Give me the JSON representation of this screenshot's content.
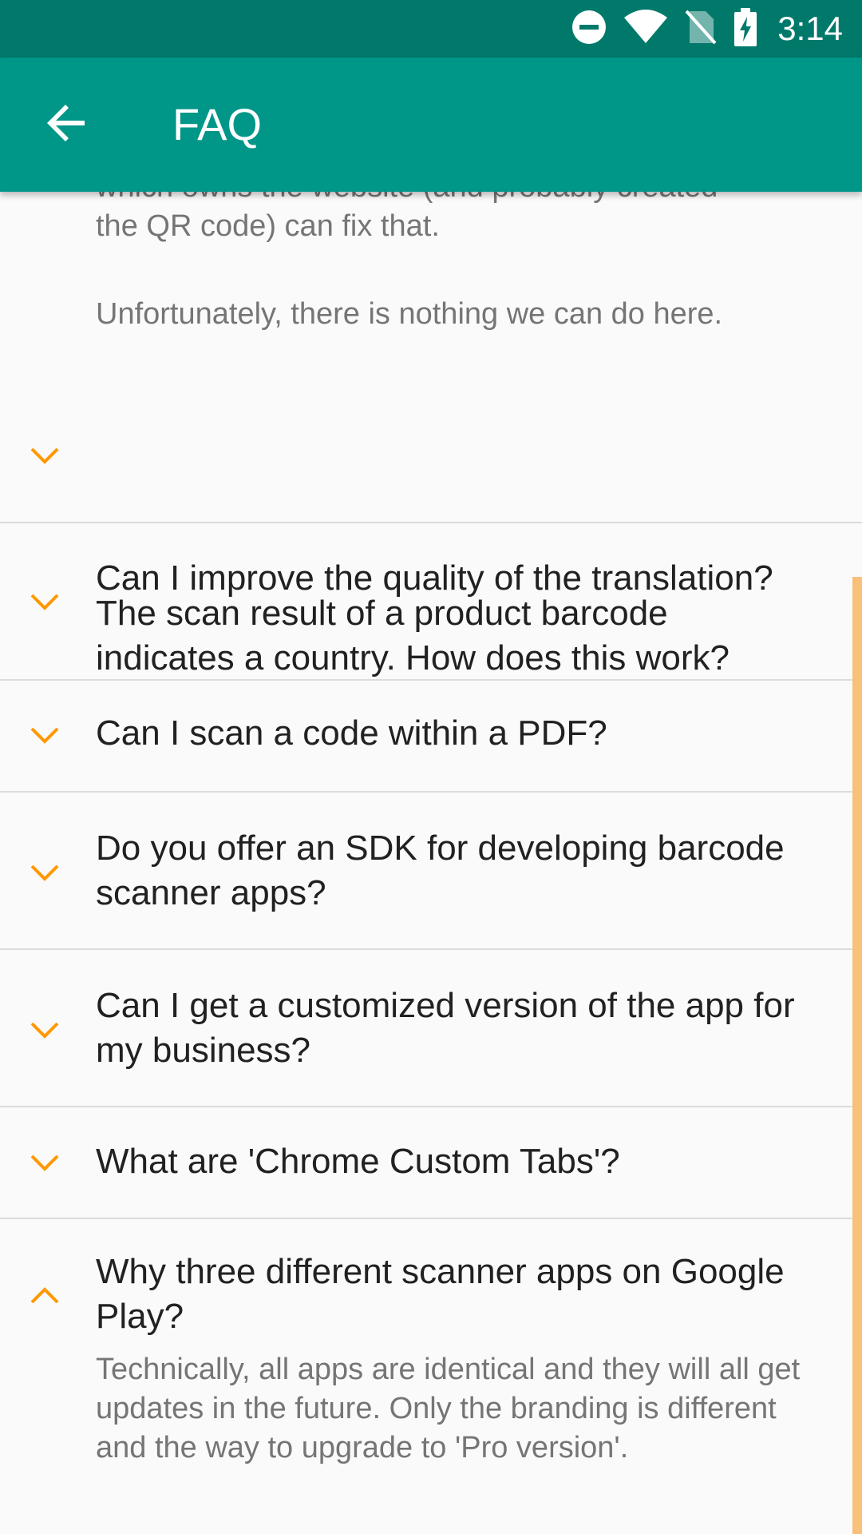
{
  "status_bar": {
    "time": "3:14",
    "icons": [
      "do-not-disturb-icon",
      "wifi-icon",
      "no-sim-icon",
      "battery-charging-icon"
    ]
  },
  "app_bar": {
    "title": "FAQ",
    "back_icon": "arrow-back-icon"
  },
  "colors": {
    "status_bar": "#00796b",
    "app_bar": "#009688",
    "accent": "#ff9800",
    "question_text": "#212121",
    "answer_text": "#757575",
    "scrollbar": "#f9c07a"
  },
  "top_answer": {
    "paragraph_1": "which owns the website (and probably created\nthe QR code) can fix that.",
    "paragraph_2": "Unfortunately, there is nothing we can do here."
  },
  "faq_items": [
    {
      "question": "The scan result of a product barcode indicates a country. How does this work?",
      "expanded": false
    },
    {
      "question": "Can I improve the quality of the translation?",
      "expanded": false
    },
    {
      "question": "Can I scan a code within a PDF?",
      "expanded": false
    },
    {
      "question": "Do you offer an SDK for developing barcode scanner apps?",
      "expanded": false
    },
    {
      "question": "Can I get a customized version of the app for my business?",
      "expanded": false
    },
    {
      "question": "What are 'Chrome Custom Tabs'?",
      "expanded": false
    },
    {
      "question": "Why three different scanner apps on Google Play?",
      "expanded": true
    }
  ],
  "expanded_answer": "Technically, all apps are identical and they will all get updates in the future. Only the branding is different and the way to upgrade to 'Pro version'."
}
